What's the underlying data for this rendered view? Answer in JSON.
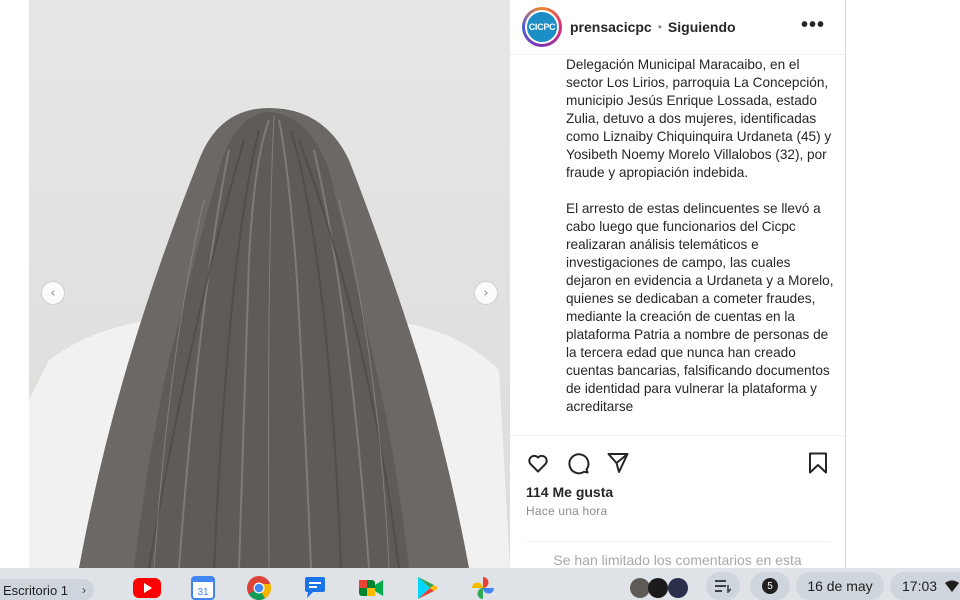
{
  "post": {
    "username": "prensacicpc",
    "separator": "•",
    "follow_status": "Siguiendo",
    "avatar_text": "CICPC",
    "more_label": "•••",
    "caption_paragraphs": [
      "Delegación Municipal Maracaibo, en el sector Los Lirios, parroquia La Concepción, municipio Jesús Enrique Lossada, estado Zulia, detuvo a dos mujeres, identificadas como Liznaiby Chiquinquira Urdaneta (45) y Yosibeth Noemy Morelo Villalobos (32), por fraude y apropiación indebida.",
      "El arresto de estas delincuentes se llevó a cabo luego que funcionarios del Cicpc realizaran análisis telemáticos e investigaciones de campo, las cuales dejaron en evidencia a Urdaneta y a Morelo, quienes se dedicaban a cometer fraudes, mediante la creación de cuentas en la plataforma Patria a nombre de personas de la tercera edad que nunca han creado cuentas bancarias, falsificando documentos de identidad para vulnerar la plataforma y acreditarse"
    ],
    "likes": "114 Me gusta",
    "time": "Hace una hora",
    "comments_limited": "Se han limitado los comentarios en esta"
  },
  "photo": {
    "prev_icon": "‹",
    "next_icon": "›"
  },
  "shelf": {
    "desk_label": "Escritorio 1",
    "desk_chevron": "›",
    "apps": [
      "youtube-icon",
      "google-calendar-icon",
      "chrome-icon",
      "messages-icon",
      "google-meet-icon",
      "play-store-icon",
      "google-photos-icon"
    ],
    "calendar_day": "31",
    "notification_count": "5",
    "date": "16 de may",
    "clock": "17:03"
  },
  "colors": {
    "text_primary": "#262626",
    "text_secondary": "#8e8e8e",
    "border": "#dbdbdb",
    "shelf_bg": "#dfe3e8"
  }
}
